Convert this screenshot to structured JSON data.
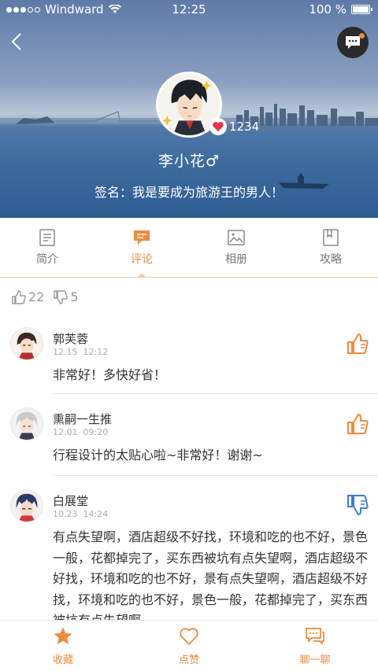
{
  "status_bar": {
    "carrier": "Windward",
    "time": "12:25",
    "battery": "100 %"
  },
  "profile": {
    "name": "李小花♂",
    "signature": "签名：我是要成为旅游王的男人！",
    "like_count": "1234"
  },
  "tabs": [
    {
      "label": "简介",
      "icon": "document-icon",
      "active": false
    },
    {
      "label": "评论",
      "icon": "comment-icon",
      "active": true
    },
    {
      "label": "相册",
      "icon": "photo-icon",
      "active": false
    },
    {
      "label": "攻略",
      "icon": "book-icon",
      "active": false
    }
  ],
  "summary": {
    "up_count": "22",
    "down_count": "5"
  },
  "comments": [
    {
      "name": "郭芙蓉",
      "date": "12.15",
      "time": "12:12",
      "text": "非常好！多快好省！",
      "vote": "up"
    },
    {
      "name": "熏嗣一生推",
      "date": "12.01",
      "time": "09:20",
      "text": "行程设计的太贴心啦~非常好！谢谢~",
      "vote": "up"
    },
    {
      "name": "白展堂",
      "date": "10.23",
      "time": "14:24",
      "text": "有点失望啊，酒店超级不好找，环境和吃的也不好，景色一般，花都掉完了，买东西被坑有点失望啊，酒店超级不好找，环境和吃的也不好，景有点失望啊，酒店超级不好找，环境和吃的也不好，景色一般，花都掉完了，买东西被坑有点失望啊",
      "vote": "down"
    }
  ],
  "bottom_bar": {
    "favorite": "收藏",
    "like": "点赞",
    "chat": "聊一聊"
  },
  "colors": {
    "accent": "#f08a3c",
    "down_vote": "#3d7dd8"
  }
}
